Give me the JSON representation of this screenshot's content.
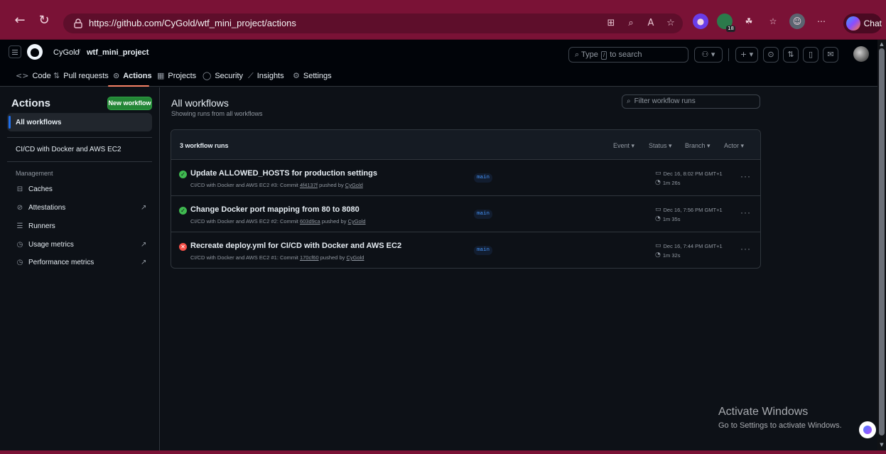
{
  "browser": {
    "url": "https://github.com/CyGold/wtf_mini_project/actions",
    "chat_label": "Chat",
    "badge_count": "18"
  },
  "header": {
    "owner": "CyGold",
    "separator": "/",
    "repo": "wtf_mini_project",
    "search_prefix": "Type",
    "search_key": "/",
    "search_suffix": "to search"
  },
  "tabs": [
    {
      "icon": "<>",
      "label": "Code"
    },
    {
      "icon": "⇅",
      "label": "Pull requests"
    },
    {
      "icon": "⊙",
      "label": "Actions"
    },
    {
      "icon": "▦",
      "label": "Projects"
    },
    {
      "icon": "◯",
      "label": "Security"
    },
    {
      "icon": "⟋",
      "label": "Insights"
    },
    {
      "icon": "⚙",
      "label": "Settings"
    }
  ],
  "sidebar": {
    "title": "Actions",
    "new_workflow": "New workflow",
    "all_workflows": "All workflows",
    "workflow": "CI/CD with Docker and AWS EC2",
    "section": "Management",
    "items": [
      {
        "label": "Caches"
      },
      {
        "label": "Attestations"
      },
      {
        "label": "Runners"
      },
      {
        "label": "Usage metrics"
      },
      {
        "label": "Performance metrics"
      }
    ]
  },
  "main": {
    "title": "All workflows",
    "subtitle": "Showing runs from all workflows",
    "filter_placeholder": "Filter workflow runs",
    "runs_count": "3 workflow runs",
    "filters": [
      "Event",
      "Status",
      "Branch",
      "Actor"
    ],
    "runs": [
      {
        "status": "success",
        "title": "Update ALLOWED_HOSTS for production settings",
        "meta_prefix": "CI/CD with Docker and AWS EC2 #3: Commit",
        "commit": "4f4137f",
        "meta_mid": "pushed by",
        "user": "CyGold",
        "branch": "main",
        "date": "Dec 16, 8:02 PM GMT+1",
        "duration": "1m 26s"
      },
      {
        "status": "success",
        "title": "Change Docker port mapping from 80 to 8080",
        "meta_prefix": "CI/CD with Docker and AWS EC2 #2: Commit",
        "commit": "603d9ca",
        "meta_mid": "pushed by",
        "user": "CyGold",
        "branch": "main",
        "date": "Dec 16, 7:56 PM GMT+1",
        "duration": "1m 35s"
      },
      {
        "status": "failure",
        "title": "Recreate deploy.yml for CI/CD with Docker and AWS EC2",
        "meta_prefix": "CI/CD with Docker and AWS EC2 #1: Commit",
        "commit": "170cf60",
        "meta_mid": "pushed by",
        "user": "CyGold",
        "branch": "main",
        "date": "Dec 16, 7:44 PM GMT+1",
        "duration": "1m 32s"
      }
    ]
  },
  "watermark": {
    "line1": "Activate Windows",
    "line2": "Go to Settings to activate Windows."
  },
  "colors": {
    "success": "#3fb950",
    "failure": "#f85149",
    "accent": "#1f6feb",
    "primary_button": "#238636",
    "browser_frame": "#7a1236"
  }
}
